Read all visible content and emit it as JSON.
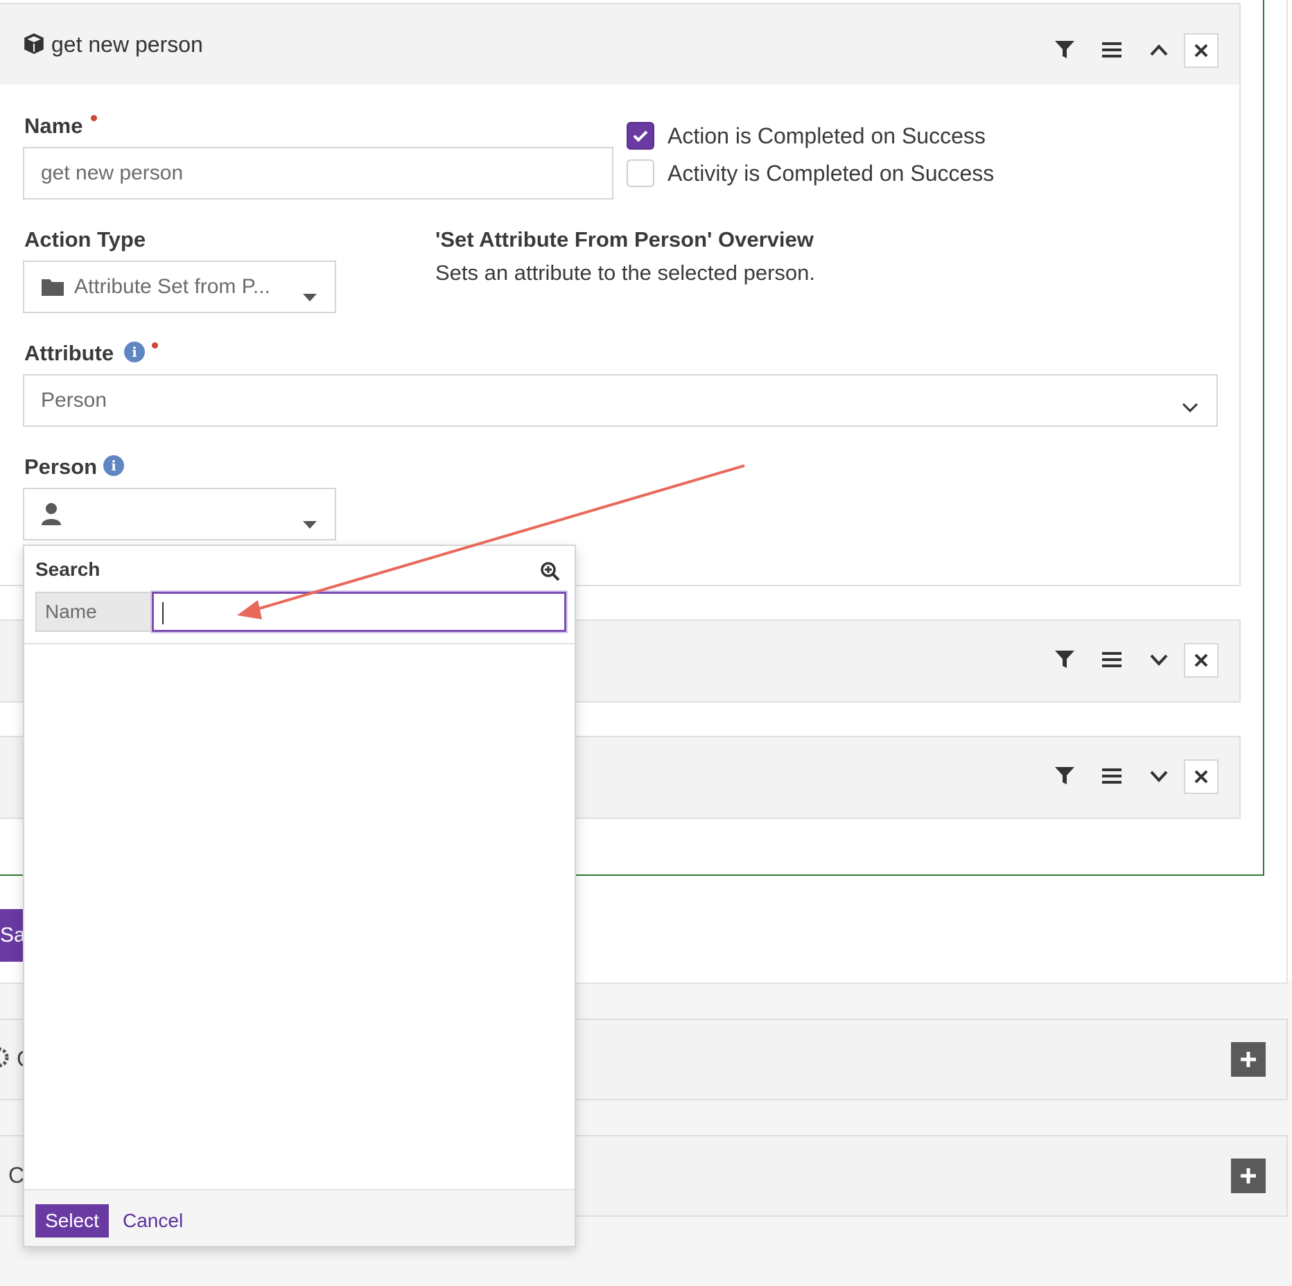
{
  "action": {
    "title": "get new person",
    "icons": [
      "cube-icon",
      "filter-icon",
      "hamburger-icon",
      "chevron-up-icon",
      "close-icon"
    ]
  },
  "form": {
    "name_label": "Name",
    "name_value": "get new person",
    "action_completed_label": "Action is Completed on Success",
    "action_completed_checked": true,
    "activity_completed_label": "Activity is Completed on Success",
    "activity_completed_checked": false,
    "action_type_label": "Action Type",
    "action_type_value": "Attribute Set from P...",
    "overview_title": "'Set Attribute From Person' Overview",
    "overview_text": "Sets an attribute to the selected person.",
    "attribute_label": "Attribute",
    "attribute_value": "Person",
    "person_label": "Person"
  },
  "picker": {
    "search_label": "Search",
    "search_field_label": "Name",
    "search_value": "",
    "select_label": "Select",
    "cancel_label": "Cancel"
  },
  "background": {
    "save_label": "Sav",
    "panel3_fragment": "C",
    "panel4_fragment": "C"
  },
  "colors": {
    "accent_purple": "#6a3aa3",
    "required_dot": "#d0443a",
    "info_blue": "#5f86c1",
    "activity_border_green": "#2f7d32",
    "annotation_arrow": "#e8695a"
  }
}
